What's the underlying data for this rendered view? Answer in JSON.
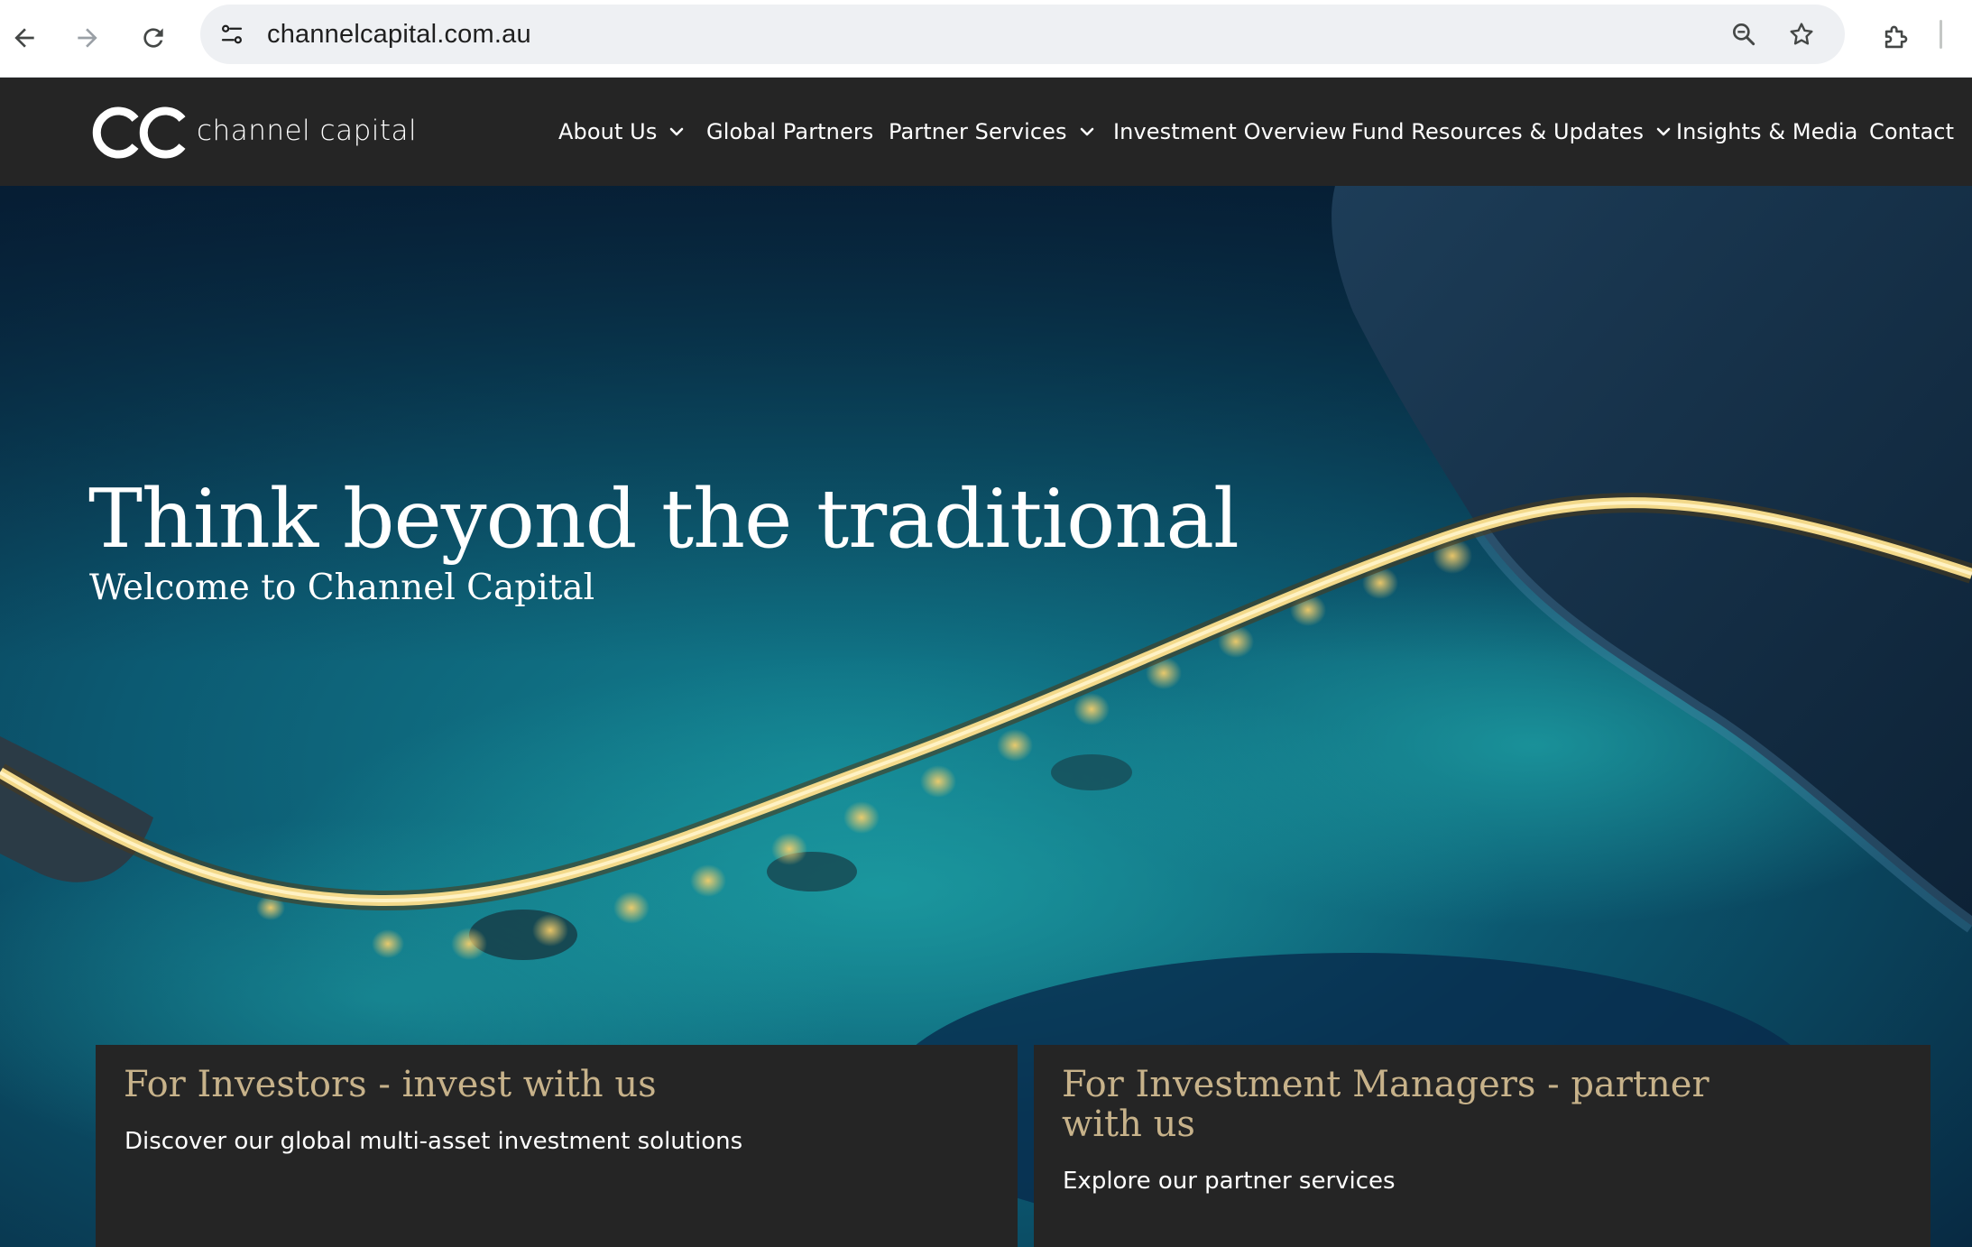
{
  "browser": {
    "url": "channelcapital.com.au"
  },
  "site": {
    "logo_text": "channel capital",
    "nav": [
      {
        "label": "About Us",
        "has_dropdown": true
      },
      {
        "label": "Global Partners",
        "has_dropdown": false
      },
      {
        "label": "Partner Services",
        "has_dropdown": true
      },
      {
        "label": "Investment Overview",
        "has_dropdown": false
      },
      {
        "label": "Fund Resources & Updates",
        "has_dropdown": true
      },
      {
        "label": "Insights & Media",
        "has_dropdown": false
      },
      {
        "label": "Contact",
        "has_dropdown": false
      }
    ]
  },
  "hero": {
    "title": "Think beyond the traditional",
    "subtitle": "Welcome to Channel Capital"
  },
  "cards": [
    {
      "title": "For Investors - invest with us",
      "text": "Discover our global multi-asset investment solutions"
    },
    {
      "title": "For Investment Managers - partner with us",
      "text": "Explore our partner services"
    }
  ],
  "colors": {
    "header_bg": "#252525",
    "card_title": "#c7b28a",
    "ocean": "#0a3548",
    "land": "#143048",
    "bridge_light": "#f3d98a"
  }
}
